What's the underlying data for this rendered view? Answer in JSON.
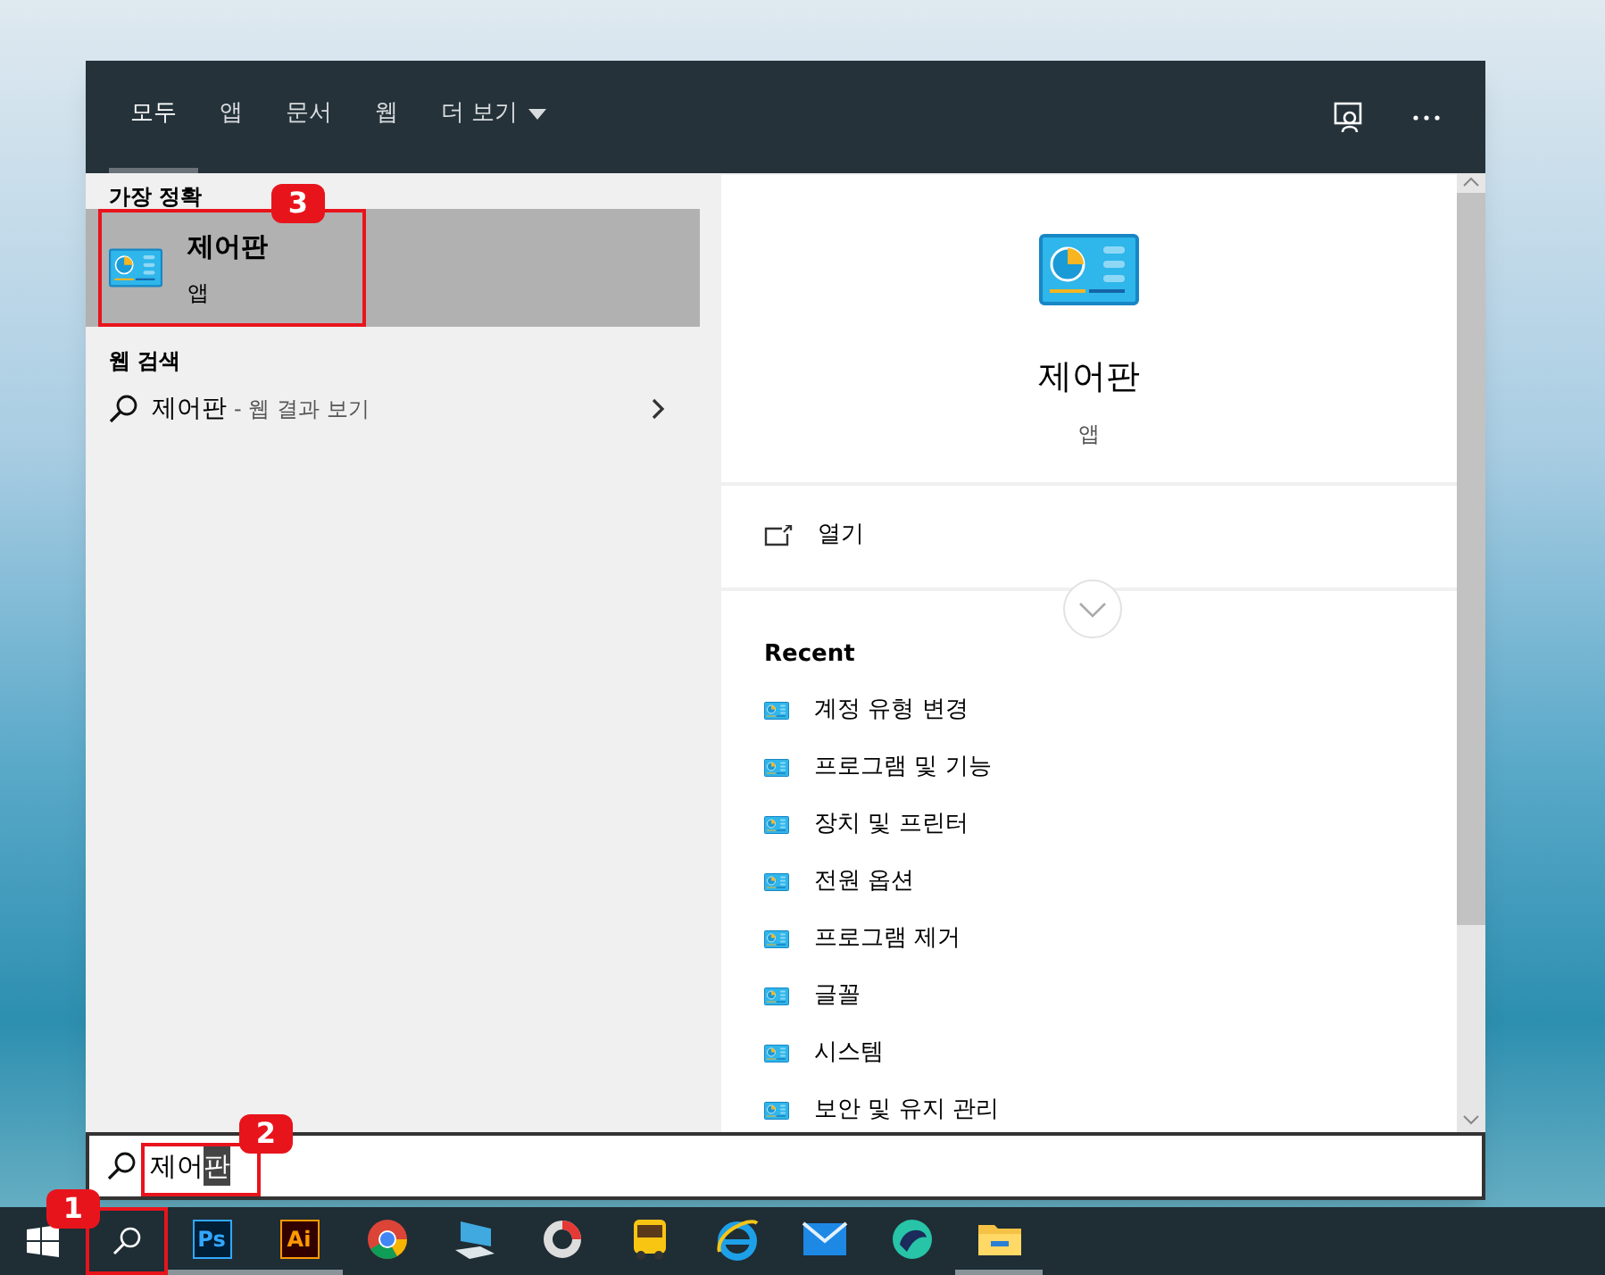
{
  "tabs": [
    {
      "label": "모두",
      "selected": true
    },
    {
      "label": "앱",
      "selected": false
    },
    {
      "label": "문서",
      "selected": false
    },
    {
      "label": "웹",
      "selected": false
    },
    {
      "label": "더 보기",
      "selected": false,
      "dropdown": true
    }
  ],
  "best_match": {
    "heading": "가장 정확",
    "title": "제어판",
    "subtitle": "앱",
    "selected": true,
    "badge": "3"
  },
  "web_search": {
    "heading": "웹 검색",
    "query": "제어판",
    "suffix": "- 웹 결과 보기"
  },
  "preview": {
    "title": "제어판",
    "subtitle": "앱",
    "action": "열기",
    "recent_heading": "Recent",
    "recent": [
      "계정 유형 변경",
      "프로그램 및 기능",
      "장치 및 프린터",
      "전원 옵션",
      "프로그램 제거",
      "글꼴",
      "시스템",
      "보안 및 유지 관리"
    ]
  },
  "search_box": {
    "text": "제어",
    "selected_text": "판",
    "badge": "2"
  },
  "taskbar": {
    "search_badge": "1",
    "apps": [
      {
        "kind": "ps",
        "label": "Ps",
        "running": true
      },
      {
        "kind": "ai",
        "label": "Ai",
        "running": true
      },
      {
        "kind": "chrome",
        "running": false
      },
      {
        "kind": "computer",
        "running": false
      },
      {
        "kind": "ring",
        "running": false
      },
      {
        "kind": "bus",
        "running": false
      },
      {
        "kind": "ie",
        "running": false
      },
      {
        "kind": "mail",
        "running": false
      },
      {
        "kind": "whale",
        "running": false
      },
      {
        "kind": "folder",
        "running": true
      }
    ]
  }
}
